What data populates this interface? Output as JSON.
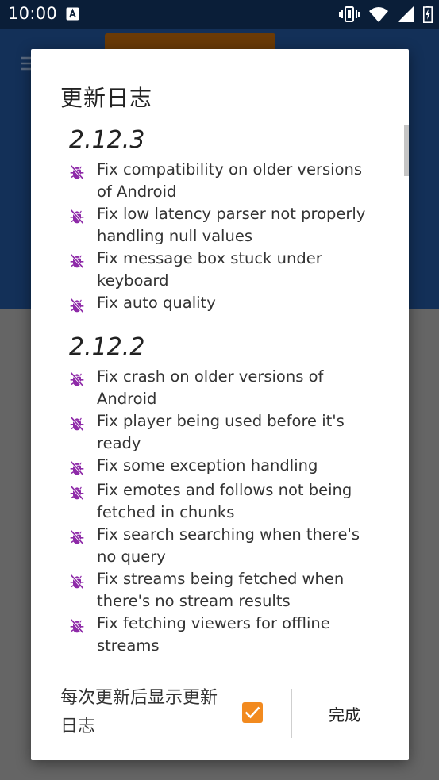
{
  "status_bar": {
    "time": "10:00",
    "icons": [
      "notification-a-icon",
      "vibrate-icon",
      "wifi-icon",
      "signal-icon",
      "battery-charging-icon"
    ]
  },
  "dialog": {
    "title": "更新日志",
    "bullet_icon": "bug-off-icon",
    "bullet_color": "#8e2aa8",
    "releases": [
      {
        "version": "2.12.3",
        "items": [
          "Fix compatibility on older versions of Android",
          "Fix low latency parser not properly handling null values",
          "Fix message box stuck under keyboard",
          "Fix auto quality"
        ]
      },
      {
        "version": "2.12.2",
        "items": [
          "Fix crash on older versions of Android",
          "Fix player being used before it's ready",
          "Fix some exception handling",
          "Fix emotes and follows not being fetched in chunks",
          "Fix search searching when there's no query",
          "Fix streams being fetched when there's no stream results",
          "Fix fetching viewers for offline streams"
        ]
      }
    ],
    "footer": {
      "show_after_update_label": "每次更新后显示更新日志",
      "show_after_update_checked": true,
      "checkbox_color": "#f28a1f",
      "done_label": "完成"
    }
  }
}
